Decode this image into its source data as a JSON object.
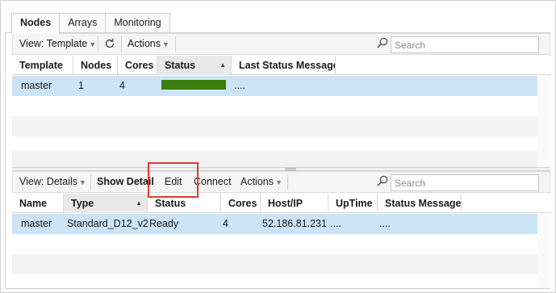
{
  "tabs": [
    {
      "label": "Nodes",
      "active": true
    },
    {
      "label": "Arrays",
      "active": false
    },
    {
      "label": "Monitoring",
      "active": false
    }
  ],
  "nodes_pane": {
    "toolbar": {
      "view_label": "View: Template",
      "refresh_icon": "refresh-icon",
      "actions_label": "Actions",
      "search_placeholder": "Search"
    },
    "columns": [
      "Template",
      "Nodes",
      "Cores",
      "Status",
      "Last Status Message"
    ],
    "sorted_column": "Status",
    "rows": [
      {
        "template": "master",
        "nodes": "1",
        "cores": "4",
        "status_bar_fraction": 1.0,
        "status_color": "#3a7d0a",
        "last_status_message": "...."
      }
    ]
  },
  "details_pane": {
    "toolbar": {
      "view_label": "View: Details",
      "show_detail_label": "Show Detail",
      "edit_label": "Edit",
      "connect_label": "Connect",
      "actions_label": "Actions",
      "search_placeholder": "Search"
    },
    "columns": [
      "Name",
      "Type",
      "Status",
      "Cores",
      "Host/IP",
      "UpTime",
      "Status Message"
    ],
    "sorted_column": "Type",
    "rows": [
      {
        "name": "master",
        "type": "Standard_D12_v2",
        "status": "Ready",
        "cores": "4",
        "host_ip": "52.186.81.231",
        "uptime": "....",
        "status_message": "...."
      }
    ]
  },
  "colors": {
    "selection": "#cce4f7",
    "status_ok": "#3a7d0a",
    "highlight": "#e53b2a"
  }
}
